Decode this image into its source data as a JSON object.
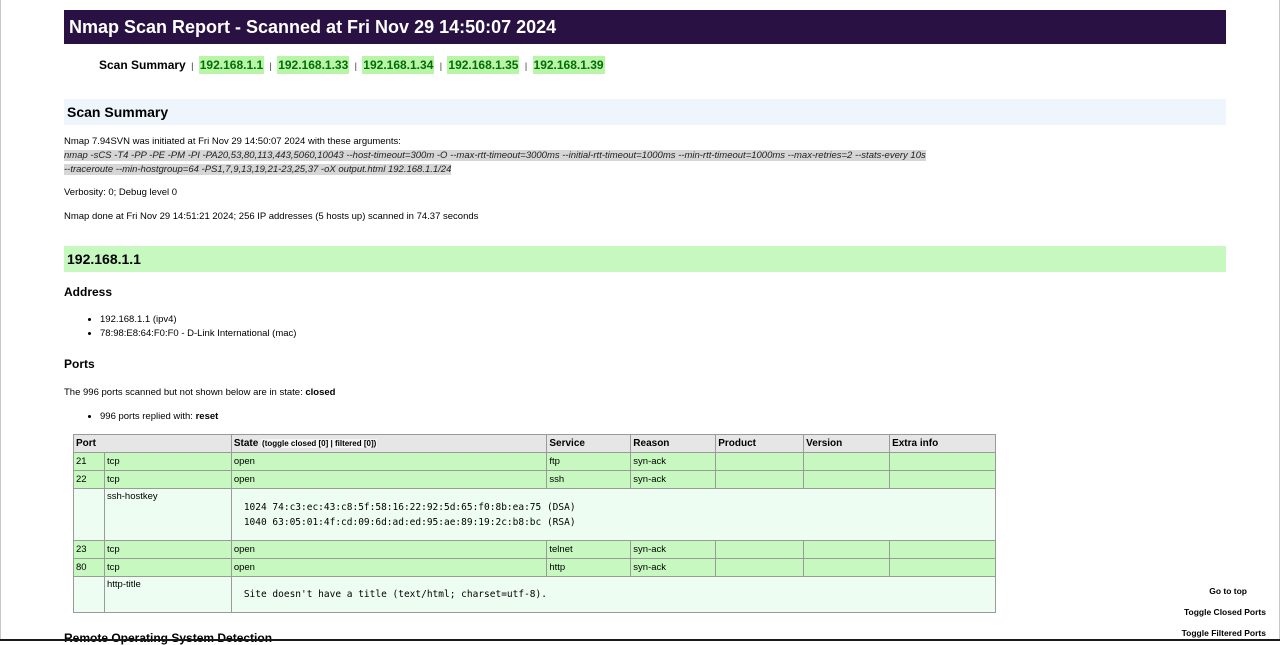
{
  "report": {
    "title": "Nmap Scan Report - Scanned at Fri Nov 29 14:50:07 2024"
  },
  "menu": {
    "label": "Scan Summary",
    "separator": "|",
    "links": [
      "192.168.1.1",
      "192.168.1.33",
      "192.168.1.34",
      "192.168.1.35",
      "192.168.1.39"
    ]
  },
  "summary": {
    "heading": "Scan Summary",
    "intro": "Nmap 7.94SVN was initiated at Fri Nov 29 14:50:07 2024 with these arguments:",
    "args_line1": "nmap -sCS -T4 -PP -PE -PM -PI -PA20,53,80,113,443,5060,10043 --host-timeout=300m -O --max-rtt-timeout=3000ms --initial-rtt-timeout=1000ms --min-rtt-timeout=1000ms --max-retries=2 --stats-every 10s",
    "args_line2": "--traceroute --min-hostgroup=64 -PS1,7,9,13,19,21-23,25,37 -oX output.html 192.168.1.1/24",
    "verbosity": "Verbosity: 0; Debug level 0",
    "done": "Nmap done at Fri Nov 29 14:51:21 2024; 256 IP addresses (5 hosts up) scanned in 74.37 seconds"
  },
  "host": {
    "heading": "192.168.1.1",
    "address_heading": "Address",
    "addresses": [
      "192.168.1.1 (ipv4)",
      "78:98:E8:64:F0:F0 - D-Link International (mac)"
    ],
    "ports_heading": "Ports",
    "ports_note_prefix": "The 996 ports scanned but not shown below are in state: ",
    "ports_note_state": "closed",
    "replied_prefix": "996 ports replied with: ",
    "replied_state": "reset",
    "table": {
      "headers": {
        "port": "Port",
        "state": "State",
        "toggle": "(toggle closed [0] | filtered [0])",
        "service": "Service",
        "reason": "Reason",
        "product": "Product",
        "version": "Version",
        "extra": "Extra info"
      },
      "rows": [
        {
          "port": "21",
          "proto": "tcp",
          "state": "open",
          "service": "ftp",
          "reason": "syn-ack"
        },
        {
          "port": "22",
          "proto": "tcp",
          "state": "open",
          "service": "ssh",
          "reason": "syn-ack"
        },
        {
          "script": "ssh-hostkey",
          "output1": "1024 74:c3:ec:43:c8:5f:58:16:22:92:5d:65:f0:8b:ea:75 (DSA)",
          "output2": "1040 63:05:01:4f:cd:09:6d:ad:ed:95:ae:89:19:2c:b8:bc (RSA)"
        },
        {
          "port": "23",
          "proto": "tcp",
          "state": "open",
          "service": "telnet",
          "reason": "syn-ack"
        },
        {
          "port": "80",
          "proto": "tcp",
          "state": "open",
          "service": "http",
          "reason": "syn-ack"
        },
        {
          "script": "http-title",
          "output1": "Site doesn't have a title (text/html; charset=utf-8)."
        }
      ]
    },
    "next_heading": "Remote Operating System Detection"
  },
  "side_nav": {
    "top": "Go to top",
    "closed": "Toggle Closed Ports",
    "filtered": "Toggle Filtered Ports"
  },
  "colors": {
    "title_bg": "#2a1143",
    "host_bg": "#c6f8bf",
    "link_bg": "#b8f5a8",
    "summary_bg": "#eef5fc"
  }
}
